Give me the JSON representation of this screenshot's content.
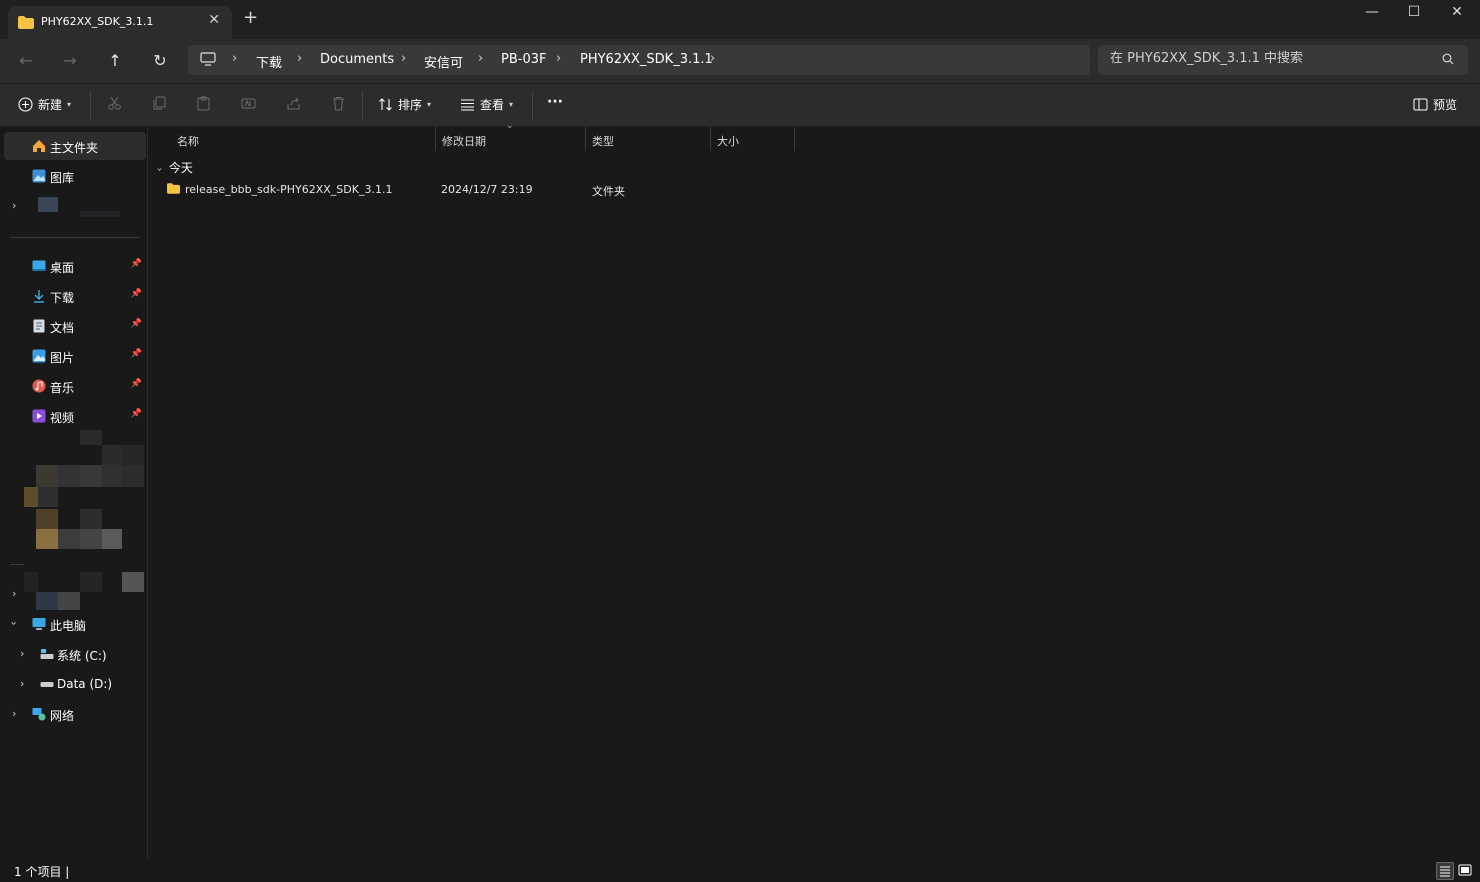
{
  "tab": {
    "title": "PHY62XX_SDK_3.1.1",
    "close": "✕",
    "new_tab": "+"
  },
  "window_controls": {
    "minimize": "—",
    "maximize": "☐",
    "close": "✕"
  },
  "nav": {
    "back": "←",
    "forward": "→",
    "up": "↑",
    "refresh": "↻"
  },
  "breadcrumb": {
    "separator": "›",
    "items": [
      "下载",
      "Documents",
      "安信可",
      "PB-03F",
      "PHY62XX_SDK_3.1.1"
    ]
  },
  "search": {
    "placeholder": "在 PHY62XX_SDK_3.1.1 中搜索"
  },
  "toolbar": {
    "new_label": "新建",
    "sort_label": "排序",
    "view_label": "查看",
    "more_label": "···",
    "preview_label": "预览"
  },
  "sidebar": {
    "home": "主文件夹",
    "gallery": "图库",
    "quick": [
      {
        "label": "桌面",
        "pin": "📌"
      },
      {
        "label": "下载",
        "pin": "📌"
      },
      {
        "label": "文档",
        "pin": "📌"
      },
      {
        "label": "图片",
        "pin": "📌"
      },
      {
        "label": "音乐",
        "pin": "📌"
      },
      {
        "label": "视频",
        "pin": "📌"
      }
    ],
    "this_pc": "此电脑",
    "drives": [
      {
        "label": "系统 (C:)"
      },
      {
        "label": "Data (D:)"
      }
    ],
    "network": "网络"
  },
  "columns": {
    "name": "名称",
    "modified": "修改日期",
    "type": "类型",
    "size": "大小"
  },
  "group": {
    "label": "今天"
  },
  "files": [
    {
      "name": "release_bbb_sdk-PHY62XX_SDK_3.1.1",
      "modified": "2024/12/7 23:19",
      "type": "文件夹",
      "size": ""
    }
  ],
  "status": {
    "count_text": "1 个项目  |"
  },
  "colors": {
    "accent": "#4cc2ff",
    "folder": "#f5c342",
    "bg": "#191919",
    "panel": "#2c2c2c"
  }
}
